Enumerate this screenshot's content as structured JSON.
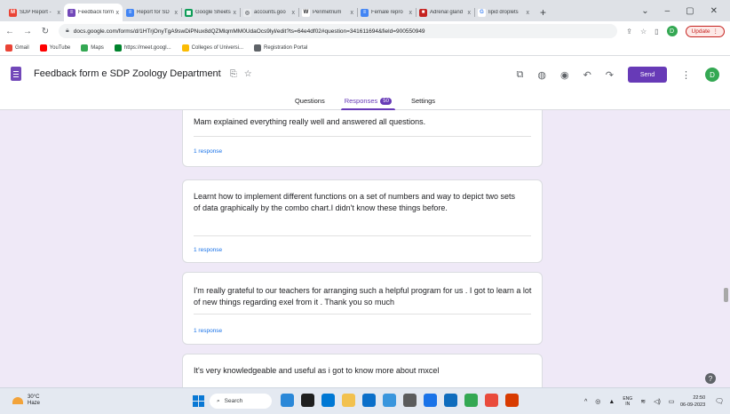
{
  "browser": {
    "tabs": [
      {
        "title": "SDP Report - ",
        "fav_color": "#ea4335",
        "fav_glyph": "M",
        "fav_text": "#ffffff"
      },
      {
        "title": "Feedback form",
        "fav_color": "#7248b9",
        "fav_glyph": "≡",
        "fav_text": "#ffffff",
        "active": true
      },
      {
        "title": "Report for SD",
        "fav_color": "#4285f4",
        "fav_glyph": "≡",
        "fav_text": "#ffffff"
      },
      {
        "title": "Google Sheets",
        "fav_color": "#0f9d58",
        "fav_glyph": "▦",
        "fav_text": "#ffffff"
      },
      {
        "title": "accounts.goo",
        "fav_color": "#e8eaed",
        "fav_glyph": "◎",
        "fav_text": "#5f6368"
      },
      {
        "title": "Perimetrium",
        "fav_color": "#ffffff",
        "fav_glyph": "W",
        "fav_text": "#202124"
      },
      {
        "title": "Female repro",
        "fav_color": "#4285f4",
        "fav_glyph": "≡",
        "fav_text": "#ffffff"
      },
      {
        "title": "Adrenal gland",
        "fav_color": "#c5221f",
        "fav_glyph": "■",
        "fav_text": "#ffffff"
      },
      {
        "title": "lipid droplets",
        "fav_color": "#ffffff",
        "fav_glyph": "G",
        "fav_text": "#4285f4"
      }
    ],
    "tab_close": "x",
    "new_tab": "+",
    "window_controls": [
      "⌄",
      "–",
      "▢",
      "✕"
    ],
    "url": "docs.google.com/forms/d/1HTrjOnyTgA9swDiPNux8dQZMlqmMM0UdaOcs9lyl/edit?ts=64e4df02#question=341611694&field=900550949",
    "profile_initial": "D",
    "update_label": "Update",
    "bookmarks": [
      {
        "label": "Gmail",
        "color": "#ea4335"
      },
      {
        "label": "YouTube",
        "color": "#ff0000"
      },
      {
        "label": "Maps",
        "color": "#34a853"
      },
      {
        "label": "https://meet.googl...",
        "color": "#00832d"
      },
      {
        "label": "Colleges of Universi...",
        "color": "#fbbc04"
      },
      {
        "label": "Registration Portal",
        "color": "#5f6368"
      }
    ]
  },
  "form": {
    "title": "Feedback form e SDP Zoology Department",
    "send_label": "Send",
    "account_initial": "D",
    "tabs": {
      "questions": "Questions",
      "responses": "Responses",
      "responses_count": "50",
      "settings": "Settings"
    }
  },
  "responses": [
    {
      "text": "Mam explained everything really well and answered all questions.",
      "count_label": "1 response"
    },
    {
      "text": "Learnt how to implement different functions on a set of numbers and way to depict two sets of data graphically by the combo chart.I didn't know these things before.",
      "count_label": "1 response"
    },
    {
      "text": "I'm really grateful to our teachers for arranging such a helpful program for us . I got to learn a lot of new things regarding exel from it . Thank you so much",
      "count_label": "1 response"
    },
    {
      "text": "It's very knowledgeable and useful as i got to know more about mxcel",
      "count_label": ""
    }
  ],
  "taskbar": {
    "weather_temp": "30°C",
    "weather_desc": "Haze",
    "search_label": "Search",
    "app_colors": [
      "#2b88d8",
      "#1f1f1f",
      "#0078d4",
      "#f2c14e",
      "#0b6fc9",
      "#3a96dd",
      "#5c5c5c",
      "#1a73e8",
      "#0f6cbd",
      "#34a853",
      "#e94b3c",
      "#d83b01"
    ],
    "lang_top": "ENG",
    "lang_bottom": "IN",
    "time": "22:50",
    "date": "06-09-2023"
  }
}
